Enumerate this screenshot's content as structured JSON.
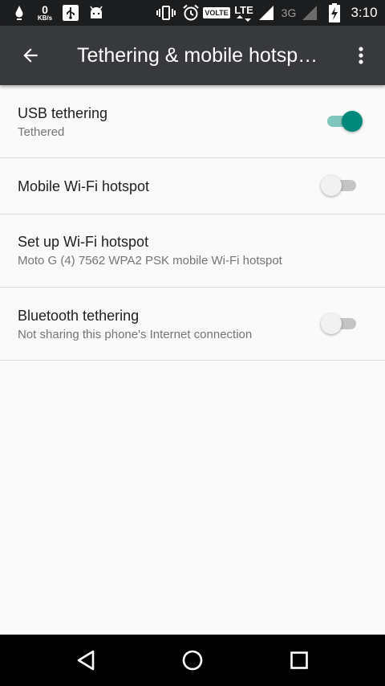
{
  "status_bar": {
    "data_speed_value": "0",
    "data_speed_unit": "KB/s",
    "volte": "VOLTE",
    "lte": "LTE",
    "network_3g": "3G",
    "time": "3:10"
  },
  "app_bar": {
    "title": "Tethering & mobile hotsp…",
    "back_icon": "arrow-back-icon",
    "overflow_icon": "more-vert-icon"
  },
  "settings": [
    {
      "title": "USB tethering",
      "subtitle": "Tethered",
      "switch_on": true
    },
    {
      "title": "Mobile Wi-Fi hotspot",
      "switch_on": false
    },
    {
      "title": "Set up Wi-Fi hotspot",
      "subtitle": "Moto G (4) 7562 WPA2 PSK mobile Wi-Fi hotspot"
    },
    {
      "title": "Bluetooth tethering",
      "subtitle": "Not sharing this phone's Internet connection",
      "switch_on": false
    }
  ],
  "colors": {
    "switch_on_thumb": "#00897b",
    "switch_on_track": "#7fc7bd",
    "app_bar": "#37393d",
    "status_bar": "#1c1d1f"
  }
}
